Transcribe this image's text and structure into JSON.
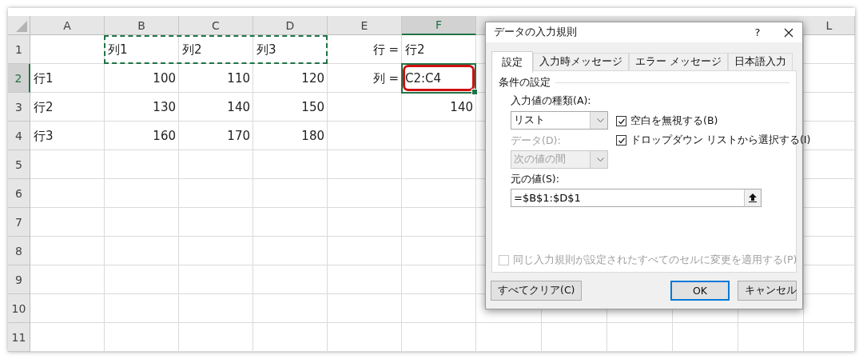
{
  "sheet": {
    "columns": [
      {
        "label": "A",
        "selected": false
      },
      {
        "label": "B",
        "selected": false
      },
      {
        "label": "C",
        "selected": false
      },
      {
        "label": "D",
        "selected": false
      },
      {
        "label": "E",
        "selected": false
      },
      {
        "label": "F",
        "selected": true
      },
      {
        "label": "L",
        "selected": false
      }
    ],
    "rows": [
      {
        "label": "1",
        "selected": false,
        "cells": [
          null,
          {
            "text": "列1",
            "kind": "text",
            "copy_range": true
          },
          {
            "text": "列2",
            "kind": "text",
            "copy_range": true
          },
          {
            "text": "列3",
            "kind": "text",
            "copy_range": true
          },
          {
            "text": "行 =",
            "kind": "label"
          },
          {
            "text": "行2",
            "kind": "text"
          }
        ]
      },
      {
        "label": "2",
        "selected": true,
        "cells": [
          {
            "text": "行1",
            "kind": "text"
          },
          {
            "text": "100",
            "kind": "number"
          },
          {
            "text": "110",
            "kind": "number"
          },
          {
            "text": "120",
            "kind": "number"
          },
          {
            "text": "列 =",
            "kind": "label"
          },
          {
            "text": "C2:C4",
            "kind": "text",
            "active": true,
            "highlighted": true
          }
        ]
      },
      {
        "label": "3",
        "selected": false,
        "cells": [
          {
            "text": "行2",
            "kind": "text"
          },
          {
            "text": "130",
            "kind": "number"
          },
          {
            "text": "140",
            "kind": "number"
          },
          {
            "text": "150",
            "kind": "number"
          },
          null,
          {
            "text": "140",
            "kind": "number"
          }
        ]
      },
      {
        "label": "4",
        "selected": false,
        "cells": [
          {
            "text": "行3",
            "kind": "text"
          },
          {
            "text": "160",
            "kind": "number"
          },
          {
            "text": "170",
            "kind": "number"
          },
          {
            "text": "180",
            "kind": "number"
          },
          null,
          null
        ]
      },
      {
        "label": "5",
        "selected": false,
        "cells": []
      },
      {
        "label": "6",
        "selected": false,
        "cells": []
      },
      {
        "label": "7",
        "selected": false,
        "cells": []
      },
      {
        "label": "8",
        "selected": false,
        "cells": []
      },
      {
        "label": "9",
        "selected": false,
        "cells": []
      },
      {
        "label": "10",
        "selected": false,
        "cells": []
      },
      {
        "label": "11",
        "selected": false,
        "cells": []
      }
    ]
  },
  "dialog": {
    "title": "データの入力規則",
    "help": "?",
    "tabs": [
      {
        "label": "設定",
        "selected": true
      },
      {
        "label": "入力時メッセージ",
        "selected": false
      },
      {
        "label": "エラー メッセージ",
        "selected": false
      },
      {
        "label": "日本語入力",
        "selected": false
      }
    ],
    "group_title": "条件の設定",
    "allow": {
      "label": "入力値の種類(A):",
      "value": "リスト",
      "disabled": false
    },
    "data": {
      "label": "データ(D):",
      "value": "次の値の間",
      "disabled": true
    },
    "options": [
      {
        "label": "空白を無視する(B)",
        "checked": true,
        "disabled": false
      },
      {
        "label": "ドロップダウン リストから選択する(I)",
        "checked": true,
        "disabled": false
      }
    ],
    "source": {
      "label": "元の値(S):",
      "value": "=$B$1:$D$1"
    },
    "apply_all": {
      "label": "同じ入力規則が設定されたすべてのセルに変更を適用する(P)",
      "checked": false,
      "disabled": true
    },
    "buttons": [
      {
        "label": "すべてクリア(C)",
        "default": false
      },
      {
        "label": "OK",
        "default": true
      },
      {
        "label": "キャンセル",
        "default": false
      }
    ]
  }
}
